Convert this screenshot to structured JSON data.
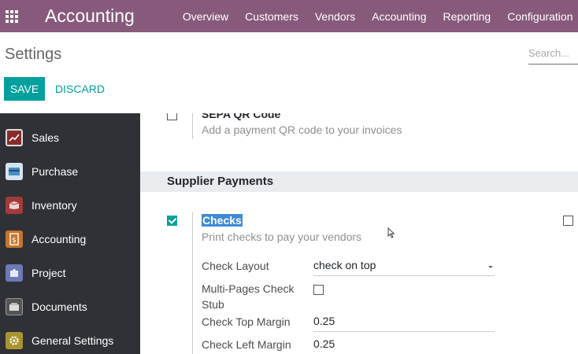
{
  "navbar": {
    "brand": "Accounting",
    "menu": [
      "Overview",
      "Customers",
      "Vendors",
      "Accounting",
      "Reporting",
      "Configuration"
    ]
  },
  "control_panel": {
    "title": "Settings",
    "search_placeholder": "Search...",
    "save_label": "SAVE",
    "discard_label": "DISCARD"
  },
  "sidebar": {
    "items": [
      {
        "label": "Sales",
        "icon": "sales-chart-icon",
        "color": "#c0392b"
      },
      {
        "label": "Purchase",
        "icon": "purchase-card-icon",
        "color": "#4a90c2"
      },
      {
        "label": "Inventory",
        "icon": "inventory-box-icon",
        "color": "#c0392b"
      },
      {
        "label": "Accounting",
        "icon": "accounting-doc-icon",
        "color": "#d9822b",
        "active": true
      },
      {
        "label": "Project",
        "icon": "project-puzzle-icon",
        "color": "#6c7ab5"
      },
      {
        "label": "Documents",
        "icon": "documents-box-icon",
        "color": "#7a7a7a"
      },
      {
        "label": "General Settings",
        "icon": "gear-icon",
        "color": "#b5a033"
      }
    ]
  },
  "content": {
    "sepa": {
      "title": "SEPA QR Code",
      "desc": "Add a payment QR code to your invoices",
      "checked": false
    },
    "section_title": "Supplier Payments",
    "checks": {
      "title": "Checks",
      "desc": "Print checks to pay your vendors",
      "checked": true,
      "fields": {
        "layout_label": "Check Layout",
        "layout_value": "check on top",
        "multipage_label": "Multi-Pages Check Stub",
        "top_margin_label": "Check Top Margin",
        "top_margin_value": "0.25",
        "left_margin_label": "Check Left Margin",
        "left_margin_value": "0.25"
      }
    }
  },
  "colors": {
    "brand": "#875a7b",
    "accent": "#00a09d",
    "sidebar": "#2f3136"
  }
}
